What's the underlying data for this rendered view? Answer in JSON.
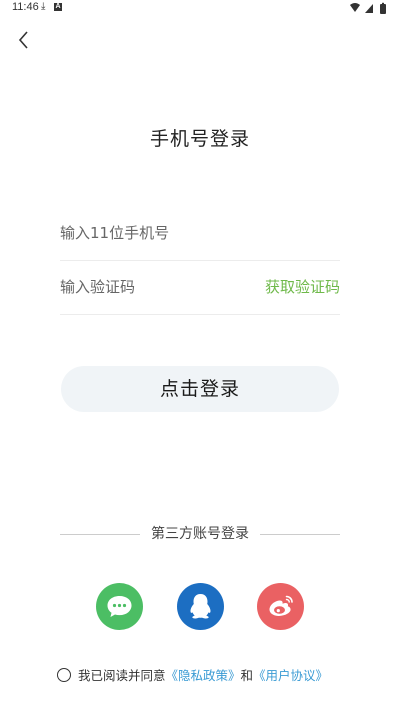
{
  "status_bar": {
    "time": "11:46",
    "download_glyph": "⤓",
    "a_glyph": "A"
  },
  "header": {
    "title": "手机号登录"
  },
  "form": {
    "phone_placeholder": "输入11位手机号",
    "code_placeholder": "输入验证码",
    "get_code_label": "获取验证码",
    "login_label": "点击登录"
  },
  "third_party": {
    "divider_label": "第三方账号登录",
    "options": [
      "wechat-icon",
      "qq-icon",
      "weibo-icon"
    ]
  },
  "agreement": {
    "prefix": "我已阅读并同意",
    "privacy_link": "《隐私政策》",
    "connector": "和",
    "terms_link": "《用户协议》",
    "checked": false
  },
  "colors": {
    "accent_green": "#6fb94a",
    "wechat": "#4cbe64",
    "qq": "#1c6ec2",
    "weibo": "#ea6163",
    "link_blue": "#3a9bd4",
    "login_button_bg": "#f0f4f7"
  }
}
